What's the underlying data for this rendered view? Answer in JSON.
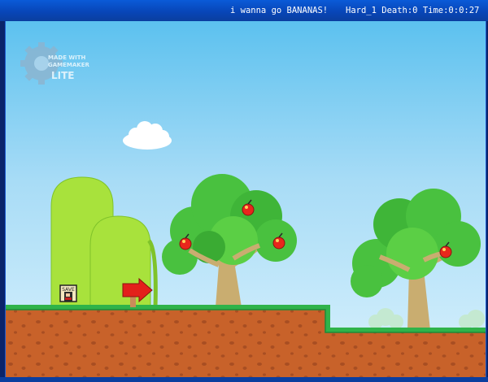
{
  "window": {
    "game_title": "i wanna go BANANAS!",
    "hud": "Hard_1 Death:0 Time:0:0:27"
  },
  "logo": {
    "line1": "MADE WITH",
    "line2": "GAMEMAKER",
    "line3": "LITE"
  },
  "save_point": {
    "label": "SAVE"
  },
  "colors": {
    "sky_top": "#5cc1ef",
    "sky_bottom": "#d8f1fd",
    "grass": "#2fb34a",
    "dirt": "#c8622a",
    "dirt_spot": "#a84e22",
    "hill": "#a8e23c",
    "tree_leaf": "#49c13f",
    "tree_trunk": "#c9ad70",
    "cherry": "#e8261c",
    "arrow": "#e3201b",
    "window_frame": "#0a5bd8"
  },
  "icons": {
    "logo": "gamemaker-gear-icon",
    "cloud": "cloud-icon",
    "player": "player-kid-icon",
    "cherry": "delicious-fruit-icon",
    "arrow": "arrow-sign-icon",
    "save": "save-point-icon"
  }
}
